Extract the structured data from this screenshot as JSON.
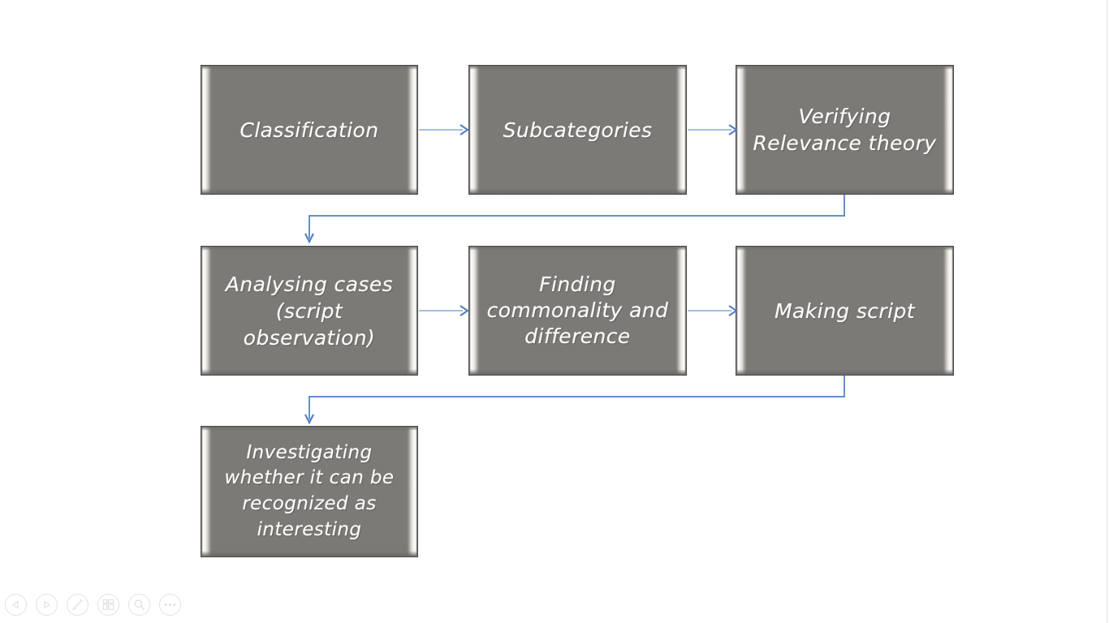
{
  "slide": {
    "background_color": "#ffffff",
    "box_fill_color": "#7c7a77",
    "box_text_color": "#fdfcfa",
    "connector_color": "#4f7fc4",
    "connector_line_color": "#8aa9dd",
    "toolbar_icon_color": "#e2e2e2"
  },
  "flowchart": {
    "type": "process-flow",
    "boxes": [
      {
        "id": "classification",
        "label": "Classification",
        "row": 1,
        "col": 1
      },
      {
        "id": "subcategories",
        "label": "Subcategories",
        "row": 1,
        "col": 2
      },
      {
        "id": "verifying-relevance-theory",
        "label": "Verifying\nRelevance theory",
        "row": 1,
        "col": 3
      },
      {
        "id": "analysing-cases",
        "label": "Analysing cases\n(script observation)",
        "row": 2,
        "col": 1
      },
      {
        "id": "finding-commonality",
        "label": "Finding\ncommonality and\ndifference",
        "row": 2,
        "col": 2
      },
      {
        "id": "making-script",
        "label": "Making   script",
        "row": 2,
        "col": 3
      },
      {
        "id": "investigating-interesting",
        "label": "Investigating\nwhether it can be\nrecognized as\ninteresting",
        "row": 3,
        "col": 1
      }
    ],
    "connectors": [
      {
        "from": "classification",
        "to": "subcategories",
        "kind": "straight-right"
      },
      {
        "from": "subcategories",
        "to": "verifying-relevance-theory",
        "kind": "straight-right"
      },
      {
        "from": "verifying-relevance-theory",
        "to": "analysing-cases",
        "kind": "elbow-down-left"
      },
      {
        "from": "analysing-cases",
        "to": "finding-commonality",
        "kind": "straight-right"
      },
      {
        "from": "finding-commonality",
        "to": "making-script",
        "kind": "straight-right"
      },
      {
        "from": "making-script",
        "to": "investigating-interesting",
        "kind": "elbow-down-left"
      }
    ]
  },
  "toolbar": {
    "buttons": [
      {
        "name": "previous-slide-button",
        "icon": "triangle-left-icon",
        "label": "Previous"
      },
      {
        "name": "next-slide-button",
        "icon": "triangle-right-icon",
        "label": "Next"
      },
      {
        "name": "pen-tool-button",
        "icon": "pen-icon",
        "label": "Pen"
      },
      {
        "name": "all-slides-button",
        "icon": "grid-slides-icon",
        "label": "See all slides"
      },
      {
        "name": "zoom-slide-button",
        "icon": "magnifier-icon",
        "label": "Zoom into the slide"
      },
      {
        "name": "more-options-button",
        "icon": "ellipsis-icon",
        "label": "More slide show options"
      }
    ]
  }
}
